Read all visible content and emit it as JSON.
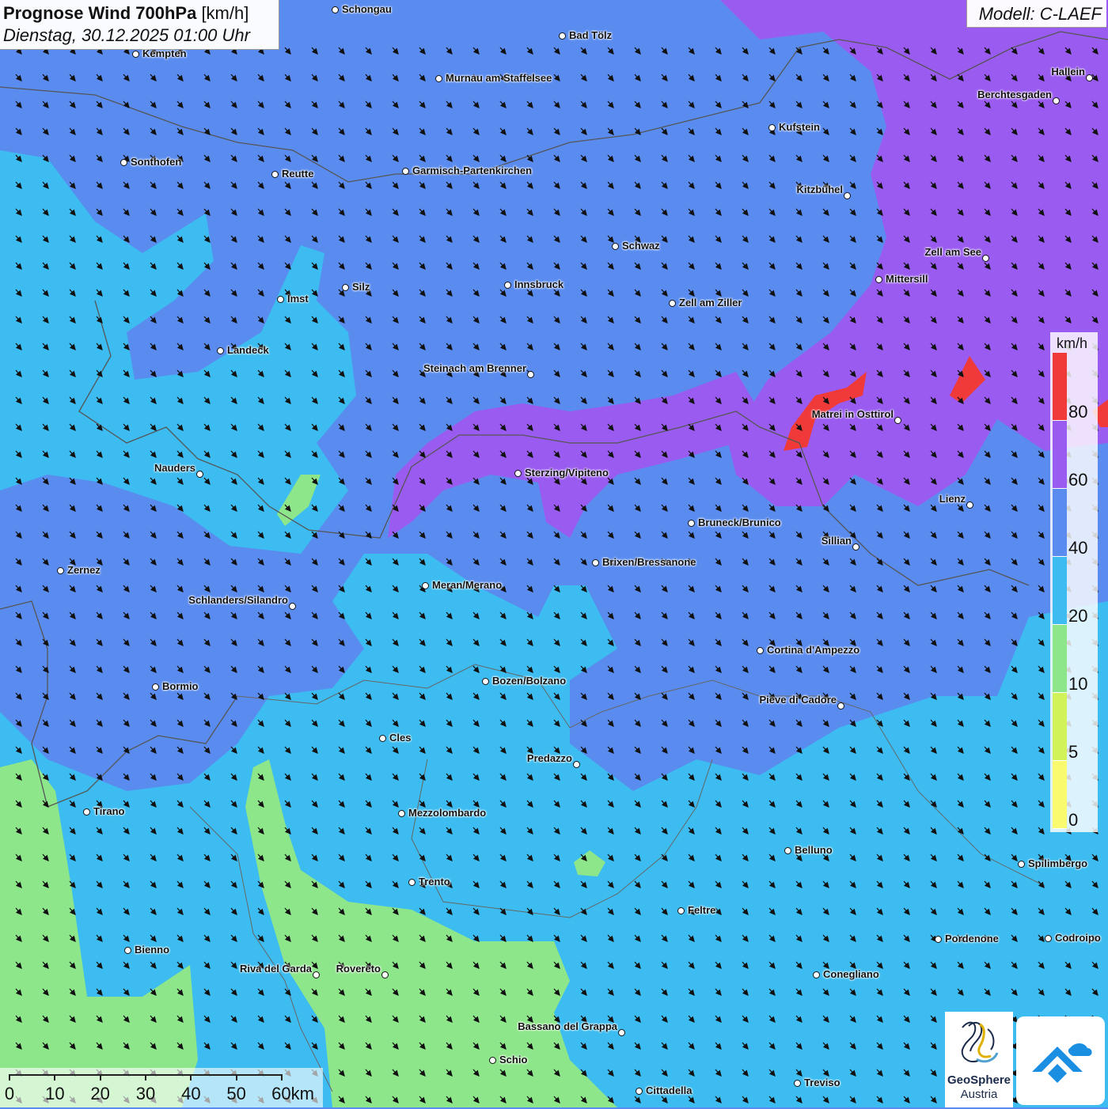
{
  "header": {
    "title": "Prognose Wind 700hPa",
    "unit": "[km/h]",
    "datetime": "Dienstag, 30.12.2025 01:00 Uhr",
    "model": "Modell: C-LAEF"
  },
  "legend": {
    "unit": "km/h",
    "labels": [
      "80",
      "60",
      "40",
      "20",
      "10",
      "5",
      "0"
    ],
    "colors": [
      "#f03a3a",
      "#9a5cf0",
      "#5a8cf0",
      "#3cbcf0",
      "#8ee68a",
      "#d2f25a",
      "#fafa6e"
    ]
  },
  "scale_bar": {
    "labels": [
      "0",
      "10",
      "20",
      "30",
      "40",
      "50",
      "60km"
    ]
  },
  "cities": [
    {
      "name": "Schongau"
    },
    {
      "name": "Bad Tölz"
    },
    {
      "name": "Kempten"
    },
    {
      "name": "Murnau am Staffelsee"
    },
    {
      "name": "Hallein"
    },
    {
      "name": "Berchtesgaden"
    },
    {
      "name": "Kufstein"
    },
    {
      "name": "Sonthofen"
    },
    {
      "name": "Reutte"
    },
    {
      "name": "Garmisch-Partenkirchen"
    },
    {
      "name": "Kitzbühel"
    },
    {
      "name": "Schwaz"
    },
    {
      "name": "Zell am See"
    },
    {
      "name": "Mittersill"
    },
    {
      "name": "Innsbruck"
    },
    {
      "name": "Silz"
    },
    {
      "name": "Imst"
    },
    {
      "name": "Zell am Ziller"
    },
    {
      "name": "Landeck"
    },
    {
      "name": "Steinach am Brenner"
    },
    {
      "name": "Matrei in Osttirol"
    },
    {
      "name": "Nauders"
    },
    {
      "name": "Sterzing/Vipiteno"
    },
    {
      "name": "Lienz"
    },
    {
      "name": "Bruneck/Brunico"
    },
    {
      "name": "Sillian"
    },
    {
      "name": "Zernez"
    },
    {
      "name": "Brixen/Bressanone"
    },
    {
      "name": "Meran/Merano"
    },
    {
      "name": "Schlanders/Silandro"
    },
    {
      "name": "Cortina d'Ampezzo"
    },
    {
      "name": "Bozen/Bolzano"
    },
    {
      "name": "Bormio"
    },
    {
      "name": "Pieve di Cadore"
    },
    {
      "name": "Cles"
    },
    {
      "name": "Predazzo"
    },
    {
      "name": "Tirano"
    },
    {
      "name": "Mezzolombardo"
    },
    {
      "name": "Belluno"
    },
    {
      "name": "Spilimbergo"
    },
    {
      "name": "Trento"
    },
    {
      "name": "Feltre"
    },
    {
      "name": "Pordenone"
    },
    {
      "name": "Codroipo"
    },
    {
      "name": "Bienno"
    },
    {
      "name": "Riva del Garda"
    },
    {
      "name": "Rovereto"
    },
    {
      "name": "Conegliano"
    },
    {
      "name": "Bassano del Grappa"
    },
    {
      "name": "Schio"
    },
    {
      "name": "Cittadella"
    },
    {
      "name": "Treviso"
    }
  ],
  "logos": {
    "geosphere_line1": "GeoSphere",
    "geosphere_line2": "Austria"
  }
}
